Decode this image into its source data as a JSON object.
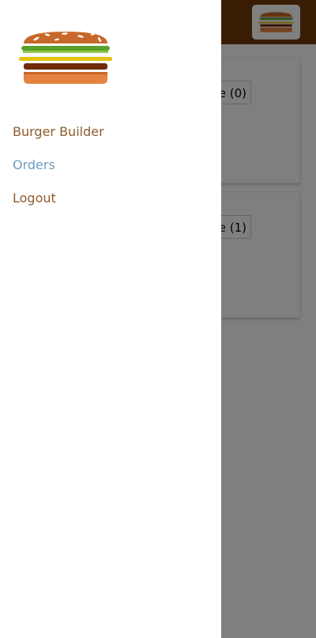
{
  "toolbar": {
    "background": "#703b09",
    "logo_icon": "burger-icon"
  },
  "orders": [
    {
      "ingredient_label": "e (0)"
    },
    {
      "ingredient_label": "e (1)"
    }
  ],
  "side_drawer": {
    "logo_icon": "burger-icon",
    "nav": [
      {
        "label": "Burger Builder",
        "active": false
      },
      {
        "label": "Orders",
        "active": true
      },
      {
        "label": "Logout",
        "active": false
      }
    ]
  },
  "colors": {
    "nav_text": "#8f5c2c",
    "nav_active": "#6a9ec0",
    "backdrop": "rgba(0,0,0,0.5)"
  }
}
